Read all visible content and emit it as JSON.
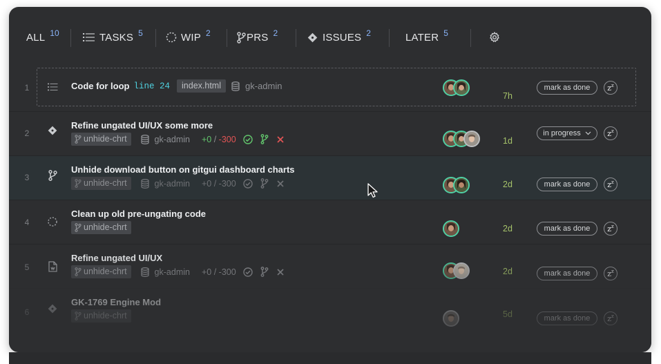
{
  "tabs": [
    {
      "label": "ALL",
      "count": "10"
    },
    {
      "label": "TASKS",
      "count": "5",
      "icon": "list-icon"
    },
    {
      "label": "WIP",
      "count": "2",
      "icon": "dotted-circle-icon"
    },
    {
      "label": "PRS",
      "count": "2",
      "icon": "branch-icon"
    },
    {
      "label": "ISSUES",
      "count": "2",
      "icon": "diamond-icon"
    },
    {
      "label": "LATER",
      "count": "5"
    }
  ],
  "settings_icon": "gear-icon",
  "rows": [
    {
      "num": "1",
      "type_icon": "list-icon",
      "title": "Code for loop",
      "line": "line 24",
      "file": "index.html",
      "repo": "gk-admin",
      "time": "7h",
      "status": "mark as done",
      "snooze": "z"
    },
    {
      "num": "2",
      "type_icon": "diamond-icon",
      "title": "Refine ungated UI/UX some more",
      "branch": "unhide-chrt",
      "repo": "gk-admin",
      "diff_add": "+0",
      "diff_sep": " / ",
      "diff_del": "-300",
      "time": "1d",
      "status": "in progress",
      "snooze": "z"
    },
    {
      "num": "3",
      "type_icon": "branch-icon",
      "title": "Unhide download button on gitgui dashboard charts",
      "branch": "unhide-chrt",
      "repo": "gk-admin",
      "diff_add": "+0",
      "diff_sep": " / ",
      "diff_del": "-300",
      "time": "2d",
      "status": "mark as done",
      "snooze": "z"
    },
    {
      "num": "4",
      "type_icon": "dotted-circle-icon",
      "title": "Clean up old pre-ungating code",
      "branch": "unhide-chrt",
      "time": "2d",
      "status": "mark as done",
      "snooze": "z"
    },
    {
      "num": "5",
      "type_icon": "file-code-icon",
      "title": "Refine ungated UI/UX",
      "branch": "unhide-chrt",
      "repo": "gk-admin",
      "diff_add": "+0",
      "diff_sep": " / ",
      "diff_del": "-300",
      "time": "2d",
      "status": "mark as done",
      "snooze": "z"
    },
    {
      "num": "6",
      "type_icon": "diamond-icon",
      "title": "GK-1769 Engine Mod",
      "branch": "unhide-chrt",
      "time": "5d",
      "status": "mark as done",
      "snooze": "z"
    }
  ],
  "colors": {
    "panel": "#2d2e30",
    "tab_count": "#8ab4f8",
    "time": "#a6c36a",
    "diff_add": "#62c46c",
    "diff_del": "#e25555",
    "line_label": "#4fd1e0",
    "avatar_ring": "#4fd1a5"
  }
}
